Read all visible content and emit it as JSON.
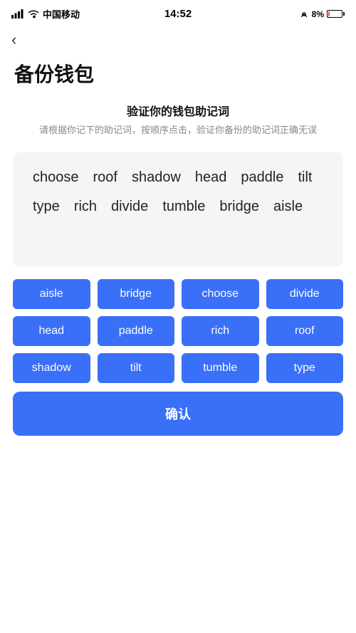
{
  "statusBar": {
    "carrier": "中国移动",
    "time": "14:52",
    "battery": "8%"
  },
  "nav": {
    "backLabel": "‹"
  },
  "page": {
    "title": "备份钱包",
    "sectionTitle": "验证你的钱包助记词",
    "sectionSubtitle": "请根据你记下的助记词，按顺序点击，验证你备份的助记词正确无误"
  },
  "displayedWords": [
    {
      "text": "choose"
    },
    {
      "text": "roof"
    },
    {
      "text": "shadow"
    },
    {
      "text": "head"
    },
    {
      "text": "paddle"
    },
    {
      "text": "tilt"
    },
    {
      "text": "type"
    },
    {
      "text": "rich"
    },
    {
      "text": "divide"
    },
    {
      "text": "tumble"
    },
    {
      "text": "bridge"
    },
    {
      "text": "aisle"
    }
  ],
  "wordButtons": [
    {
      "label": "aisle"
    },
    {
      "label": "bridge"
    },
    {
      "label": "choose"
    },
    {
      "label": "divide"
    },
    {
      "label": "head"
    },
    {
      "label": "paddle"
    },
    {
      "label": "rich"
    },
    {
      "label": "roof"
    },
    {
      "label": "shadow"
    },
    {
      "label": "tilt"
    },
    {
      "label": "tumble"
    },
    {
      "label": "type"
    }
  ],
  "confirmButton": {
    "label": "确认"
  }
}
